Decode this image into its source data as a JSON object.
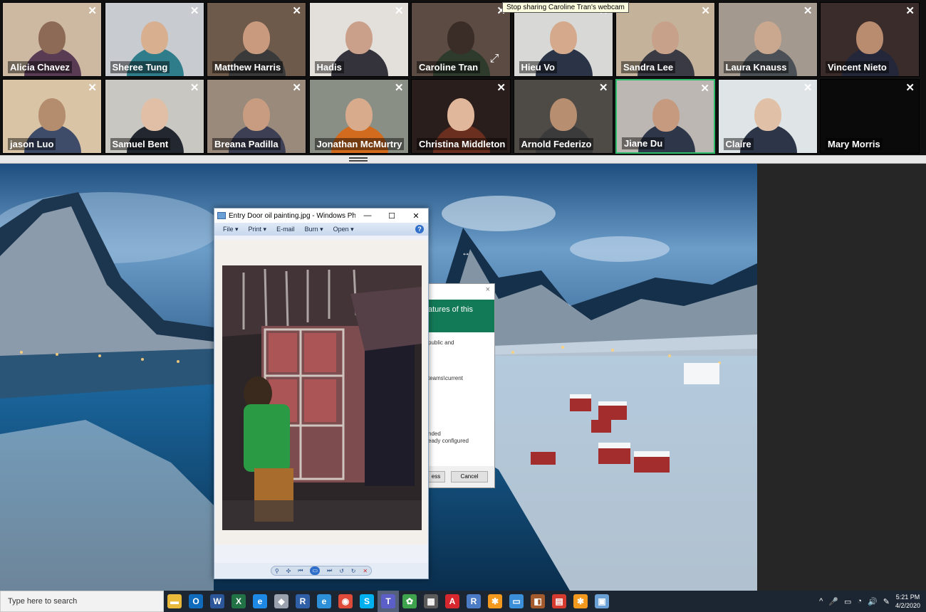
{
  "gallery": {
    "participants": [
      {
        "name": "Alicia Chavez",
        "bg": "#cdb9a2",
        "skin": "#8d6a55",
        "shirt": "#5a3b54"
      },
      {
        "name": "Sheree Tung",
        "bg": "#c8ccd1",
        "skin": "#d8b090",
        "shirt": "#2f7c8a"
      },
      {
        "name": "Matthew Harris",
        "bg": "#6d5a4b",
        "skin": "#c99a7e",
        "shirt": "#3a3a3a"
      },
      {
        "name": "Hadis",
        "bg": "#e3dfda",
        "skin": "#caa08a",
        "shirt": "#34323a"
      },
      {
        "name": "Caroline Tran",
        "bg": "#5c4b42",
        "skin": "#3a2c26",
        "shirt": "#2d3a2c"
      },
      {
        "name": "Hieu Vo",
        "bg": "#d8d8d6",
        "skin": "#d4a98c",
        "shirt": "#2b3346"
      },
      {
        "name": "Sandra Lee",
        "bg": "#c4b29a",
        "skin": "#c7a189",
        "shirt": "#3a3a44"
      },
      {
        "name": "Laura Knauss",
        "bg": "#a3998f",
        "skin": "#caa88f",
        "shirt": "#4b5057"
      },
      {
        "name": "Vincent Nieto",
        "bg": "#3a2c2a",
        "skin": "#b98c6f",
        "shirt": "#24273a"
      },
      {
        "name": "jason Luo",
        "bg": "#d9c4a5",
        "skin": "#b48c6e",
        "shirt": "#3e4c6a"
      },
      {
        "name": "Samuel Bent",
        "bg": "#c9c7c2",
        "skin": "#e1bfa6",
        "shirt": "#232830"
      },
      {
        "name": "Breana Padilla",
        "bg": "#9a8a7c",
        "skin": "#c89c80",
        "shirt": "#3d3f55"
      },
      {
        "name": "Jonathan McMurtry",
        "bg": "#8a8f86",
        "skin": "#d8ab8d",
        "shirt": "#d36b1e"
      },
      {
        "name": "Christina Middleton",
        "bg": "#2a1e1c",
        "skin": "#e0b79a",
        "shirt": "#6b2f20"
      },
      {
        "name": "Arnold Federizo",
        "bg": "#4e4a46",
        "skin": "#b78e70",
        "shirt": "#3b3b3b"
      },
      {
        "name": "Jiane Du",
        "bg": "#bdb7b3",
        "skin": "#c59a7f",
        "shirt": "#2e3749"
      },
      {
        "name": "Claire",
        "bg": "#dfe4e6",
        "skin": "#e0c1a8",
        "shirt": "#2c3648"
      },
      {
        "name": "Mary Morris",
        "bg": "#0a0a0a",
        "skin": "",
        "shirt": ""
      }
    ],
    "close_glyph": "✕",
    "tooltip": "Stop sharing Caroline Tran's webcam"
  },
  "photo_viewer": {
    "title": "Entry Door oil painting.jpg - Windows Photo...",
    "minimize": "—",
    "maximize": "☐",
    "close": "✕",
    "menu": [
      "File ▾",
      "Print ▾",
      "E-mail",
      "Burn ▾",
      "Open ▾"
    ],
    "help": "?"
  },
  "dialog": {
    "close": "×",
    "heading": "atures of this",
    "lines": [
      "public and",
      "teams\\current",
      "nded",
      "eady configured"
    ],
    "ok_label": "ess",
    "cancel_label": "Cancel"
  },
  "taskbar": {
    "search_placeholder": "Type here to search",
    "apps": [
      {
        "name": "file-explorer-icon",
        "glyph": "▬",
        "color": "#e8b93a"
      },
      {
        "name": "outlook-icon",
        "glyph": "O",
        "color": "#0f6cbd"
      },
      {
        "name": "word-icon",
        "glyph": "W",
        "color": "#2b579a"
      },
      {
        "name": "excel-icon",
        "glyph": "X",
        "color": "#217346"
      },
      {
        "name": "edge-icon",
        "glyph": "e",
        "color": "#1e88e5"
      },
      {
        "name": "app-icon",
        "glyph": "◆",
        "color": "#9aa2ad"
      },
      {
        "name": "r-app-icon",
        "glyph": "R",
        "color": "#2f5fa6"
      },
      {
        "name": "ie-icon",
        "glyph": "e",
        "color": "#2d8fd8"
      },
      {
        "name": "chrome-icon",
        "glyph": "◉",
        "color": "#de4b39"
      },
      {
        "name": "skype-icon",
        "glyph": "S",
        "color": "#00aff0"
      },
      {
        "name": "teams-icon",
        "glyph": "T",
        "color": "#5b5fc7"
      },
      {
        "name": "paint-icon",
        "glyph": "✿",
        "color": "#3fa34d"
      },
      {
        "name": "calculator-icon",
        "glyph": "▦",
        "color": "#5b5b5b"
      },
      {
        "name": "acrobat-icon",
        "glyph": "A",
        "color": "#d7282f"
      },
      {
        "name": "r-studio-icon",
        "glyph": "R",
        "color": "#4b7bc4"
      },
      {
        "name": "app2-icon",
        "glyph": "✱",
        "color": "#f39a1e"
      },
      {
        "name": "monitor-icon",
        "glyph": "▭",
        "color": "#3a8fd8"
      },
      {
        "name": "app3-icon",
        "glyph": "◧",
        "color": "#a35a2c"
      },
      {
        "name": "app4-icon",
        "glyph": "▤",
        "color": "#d53c2f"
      },
      {
        "name": "app5-icon",
        "glyph": "✱",
        "color": "#f39a1e"
      },
      {
        "name": "photos-icon",
        "glyph": "▣",
        "color": "#6aa0d4"
      }
    ],
    "time": "5:21 PM",
    "date": "4/2/2020",
    "tray": [
      "^",
      "🎤",
      "▭",
      "◔",
      "🔊",
      "✎"
    ]
  }
}
